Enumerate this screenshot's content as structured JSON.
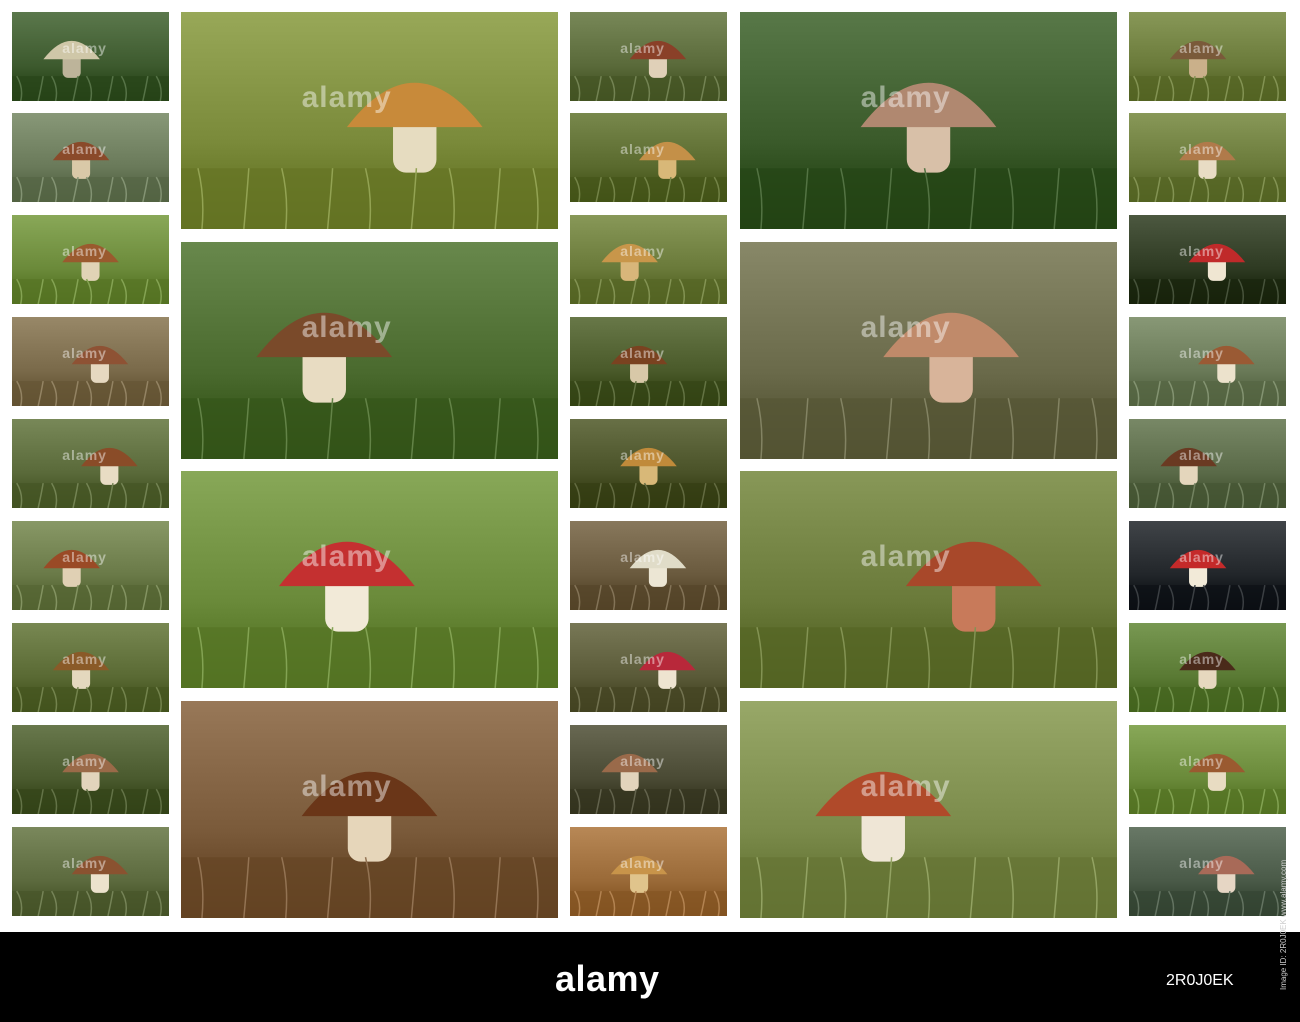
{
  "collage": {
    "watermark": "alamy",
    "tiles": [
      {
        "id": "c1-1",
        "bg": "#3d5a2e",
        "fg": "#cfc7a8",
        "stem": "#bdb49a"
      },
      {
        "id": "c1-2",
        "bg": "#6a7a5a",
        "fg": "#8a4a2a",
        "stem": "#d9c9a8"
      },
      {
        "id": "c1-3",
        "bg": "#6b8a3a",
        "fg": "#9a5a2e",
        "stem": "#e0d3b6"
      },
      {
        "id": "c1-4",
        "bg": "#7a6a4a",
        "fg": "#8e5234",
        "stem": "#e6d8c0"
      },
      {
        "id": "c1-5",
        "bg": "#5a6a3a",
        "fg": "#8a4c28",
        "stem": "#e8dcc4"
      },
      {
        "id": "c1-6",
        "bg": "#6a7a48",
        "fg": "#9a4a26",
        "stem": "#e0d0b4"
      },
      {
        "id": "c1-7",
        "bg": "#5a6a34",
        "fg": "#8a5a28",
        "stem": "#e4d8be"
      },
      {
        "id": "c1-8",
        "bg": "#4a5a2e",
        "fg": "#9a6a48",
        "stem": "#e2d4bc"
      },
      {
        "id": "c1-9",
        "bg": "#5c6a3e",
        "fg": "#8a5230",
        "stem": "#ece2cc"
      },
      {
        "id": "c2-1",
        "bg": "#7a8a3a",
        "fg": "#c88a3a",
        "stem": "#e6dcc0"
      },
      {
        "id": "c2-2",
        "bg": "#4a6a2e",
        "fg": "#7a4a2a",
        "stem": "#e8dcc2"
      },
      {
        "id": "c2-3",
        "bg": "#6a8a3a",
        "fg": "#c43030",
        "stem": "#f2ead8"
      },
      {
        "id": "c2-4",
        "bg": "#7a5a3a",
        "fg": "#6a3618",
        "stem": "#e6d6ba"
      },
      {
        "id": "c3-1",
        "bg": "#5a6a3a",
        "fg": "#8a4028",
        "stem": "#e0d0b8"
      },
      {
        "id": "c3-2",
        "bg": "#5a6a2e",
        "fg": "#c49048",
        "stem": "#d8b878"
      },
      {
        "id": "c3-3",
        "bg": "#6a7a3a",
        "fg": "#c8964a",
        "stem": "#d8b67a"
      },
      {
        "id": "c3-4",
        "bg": "#4a5a2a",
        "fg": "#7a4220",
        "stem": "#d8c8a8"
      },
      {
        "id": "c3-5",
        "bg": "#4a5228",
        "fg": "#c08a3a",
        "stem": "#d8b878"
      },
      {
        "id": "c3-6",
        "bg": "#6a5a3e",
        "fg": "#e0dcc8",
        "stem": "#ece6d4"
      },
      {
        "id": "c3-7",
        "bg": "#5a5a38",
        "fg": "#b8283a",
        "stem": "#eee4d0"
      },
      {
        "id": "c3-8",
        "bg": "#4a4a34",
        "fg": "#9a6a4a",
        "stem": "#e2d4bc"
      },
      {
        "id": "c3-9",
        "bg": "#9a6a38",
        "fg": "#c8944a",
        "stem": "#e0c48c"
      },
      {
        "id": "c4-1",
        "bg": "#3a5a2a",
        "fg": "#b08870",
        "stem": "#d8c0a8"
      },
      {
        "id": "c4-2",
        "bg": "#6a6a4a",
        "fg": "#c08a6a",
        "stem": "#d8b49a"
      },
      {
        "id": "c4-3",
        "bg": "#6a7a3a",
        "fg": "#a8482a",
        "stem": "#c87a5a"
      },
      {
        "id": "c4-4",
        "bg": "#7a8a4a",
        "fg": "#b04a2a",
        "stem": "#efe6d6"
      },
      {
        "id": "c5-1",
        "bg": "#6a7a3a",
        "fg": "#7a5a3a",
        "stem": "#cab08a"
      },
      {
        "id": "c5-2",
        "bg": "#6a7a3a",
        "fg": "#b07a4a",
        "stem": "#e8dcc4"
      },
      {
        "id": "c5-3",
        "bg": "#2e3a22",
        "fg": "#c02a2a",
        "stem": "#f0e6d2"
      },
      {
        "id": "c5-4",
        "bg": "#6a7a58",
        "fg": "#9a5a34",
        "stem": "#ece2cc"
      },
      {
        "id": "c5-5",
        "bg": "#5a6a48",
        "fg": "#6a3a22",
        "stem": "#e4d6bc"
      },
      {
        "id": "c5-6",
        "bg": "#22262a",
        "fg": "#c42a2a",
        "stem": "#f2ead8"
      },
      {
        "id": "c5-7",
        "bg": "#5a7a34",
        "fg": "#4a2a1a",
        "stem": "#e6d8be"
      },
      {
        "id": "c5-8",
        "bg": "#6a8a3a",
        "fg": "#9a5a30",
        "stem": "#e8dcc2"
      },
      {
        "id": "c5-9",
        "bg": "#4a5a48",
        "fg": "#a86a58",
        "stem": "#e6d6c4"
      }
    ]
  },
  "footer": {
    "logo": "alamy",
    "image_id": "2R0J0EK",
    "side_credit": "Image ID: 2R0J0EK www.alamy.com"
  }
}
